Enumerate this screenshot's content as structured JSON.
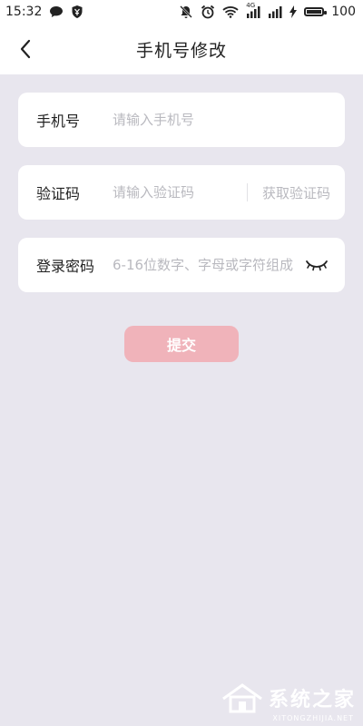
{
  "status_bar": {
    "time": "15:32",
    "network_type": "4G",
    "battery_level": "100",
    "left_icons": [
      "chat-bubble-icon",
      "shield-icon"
    ],
    "right_icons": [
      "mute-notification-icon",
      "alarm-icon",
      "wifi-icon",
      "signal-icon",
      "signal-icon",
      "charging-icon",
      "battery-icon"
    ]
  },
  "header": {
    "title": "手机号修改",
    "back_icon": "chevron-left-icon"
  },
  "form": {
    "phone": {
      "label": "手机号",
      "placeholder": "请输入手机号",
      "value": ""
    },
    "code": {
      "label": "验证码",
      "placeholder": "请输入验证码",
      "value": "",
      "get_code_label": "获取验证码"
    },
    "password": {
      "label": "登录密码",
      "placeholder": "6-16位数字、字母或字符组成",
      "value": "",
      "visibility_icon": "eye-closed-icon"
    }
  },
  "submit_label": "提交",
  "watermark": {
    "text": "系统之家",
    "sub": "XITONGZHIJIA.NET"
  },
  "colors": {
    "background": "#e8e6ee",
    "card": "#ffffff",
    "submit_button": "#f0b3ba",
    "placeholder": "#b9b9bf"
  }
}
